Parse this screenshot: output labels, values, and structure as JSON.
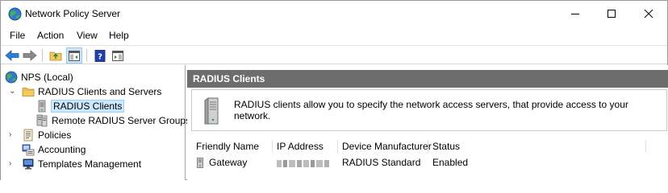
{
  "window": {
    "title": "Network Policy Server"
  },
  "menu": {
    "items": [
      "File",
      "Action",
      "View",
      "Help"
    ]
  },
  "tree": {
    "root": "NPS (Local)",
    "radius_clients_servers": "RADIUS Clients and Servers",
    "radius_clients": "RADIUS Clients",
    "remote_groups": "Remote RADIUS Server Groups",
    "policies": "Policies",
    "accounting": "Accounting",
    "templates": "Templates Management"
  },
  "pane": {
    "header": "RADIUS Clients",
    "description": "RADIUS clients allow you to specify the network access servers, that provide access to your network."
  },
  "list": {
    "columns": [
      "Friendly Name",
      "IP Address",
      "Device Manufacturer",
      "Status"
    ],
    "rows": [
      {
        "name": "Gateway",
        "ip": "",
        "manufacturer": "RADIUS Standard",
        "status": "Enabled"
      }
    ]
  },
  "colors": {
    "header_bg": "#6d6d6d",
    "selection_bg": "#cce8ff",
    "toolbar_pressed": "#cce4f7"
  }
}
